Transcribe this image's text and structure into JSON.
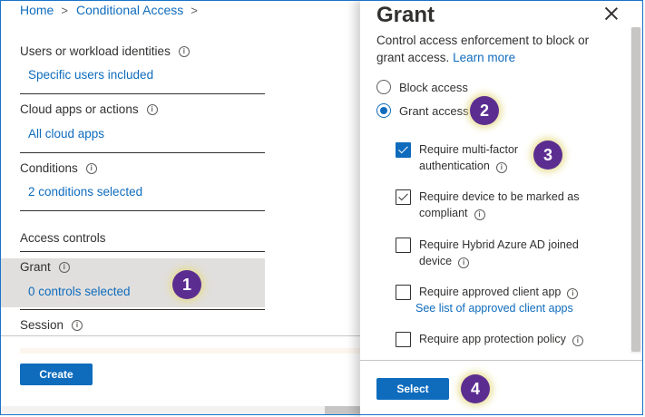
{
  "breadcrumb": {
    "home": "Home",
    "current": "Conditional Access"
  },
  "left": {
    "users": {
      "title": "Users or workload identities",
      "value": "Specific users included"
    },
    "apps": {
      "title": "Cloud apps or actions",
      "value": "All cloud apps"
    },
    "conditions": {
      "title": "Conditions",
      "value": "2 conditions selected"
    },
    "access_controls": "Access controls",
    "grant": {
      "title": "Grant",
      "value": "0 controls selected"
    },
    "session": "Session",
    "create_label": "Create"
  },
  "panel": {
    "title": "Grant",
    "description": "Control access enforcement to block or grant access.",
    "learn_more": "Learn more",
    "radios": {
      "block": "Block access",
      "grant": "Grant access",
      "selected": "Grant access"
    },
    "checks": [
      {
        "line1": "Require multi-factor",
        "line2": "authentication",
        "checked": true
      },
      {
        "line1": "Require device to be marked as",
        "line2": "compliant",
        "checked": true
      },
      {
        "line1": "Require Hybrid Azure AD joined",
        "line2": "device",
        "checked": false
      },
      {
        "line1": "Require approved client app",
        "line2": "",
        "checked": false
      },
      {
        "line1": "Require app protection policy",
        "line2": "",
        "checked": false
      }
    ],
    "approved_link": "See list of approved client apps",
    "select_label": "Select"
  },
  "markers": {
    "m1": "1",
    "m2": "2",
    "m3": "3",
    "m4": "4"
  },
  "colors": {
    "accent": "#0f6cbd",
    "marker": "#5c2d91"
  }
}
